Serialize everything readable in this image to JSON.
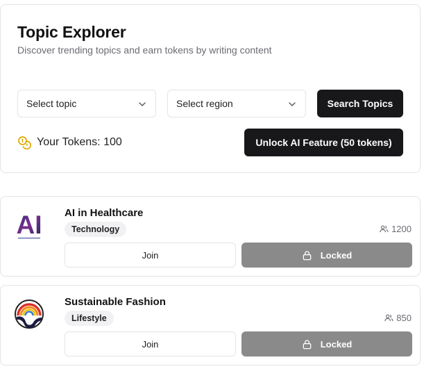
{
  "header": {
    "title": "Topic Explorer",
    "subtitle": "Discover trending topics and earn tokens by writing content"
  },
  "filters": {
    "topic_placeholder": "Select topic",
    "region_placeholder": "Select region",
    "search_label": "Search Topics"
  },
  "tokens": {
    "label": "Your Tokens: 100",
    "unlock_label": "Unlock AI Feature (50 tokens)"
  },
  "topics": [
    {
      "name": "AI in Healthcare",
      "category": "Technology",
      "members": "1200",
      "join_label": "Join",
      "locked_label": "Locked",
      "logo_text": "AI"
    },
    {
      "name": "Sustainable Fashion",
      "category": "Lifestyle",
      "members": "850",
      "join_label": "Join",
      "locked_label": "Locked"
    }
  ],
  "colors": {
    "primary": "#18181b",
    "locked": "#8a8a8a",
    "token_icon": "#e0a800",
    "border": "#e4e4e7"
  }
}
